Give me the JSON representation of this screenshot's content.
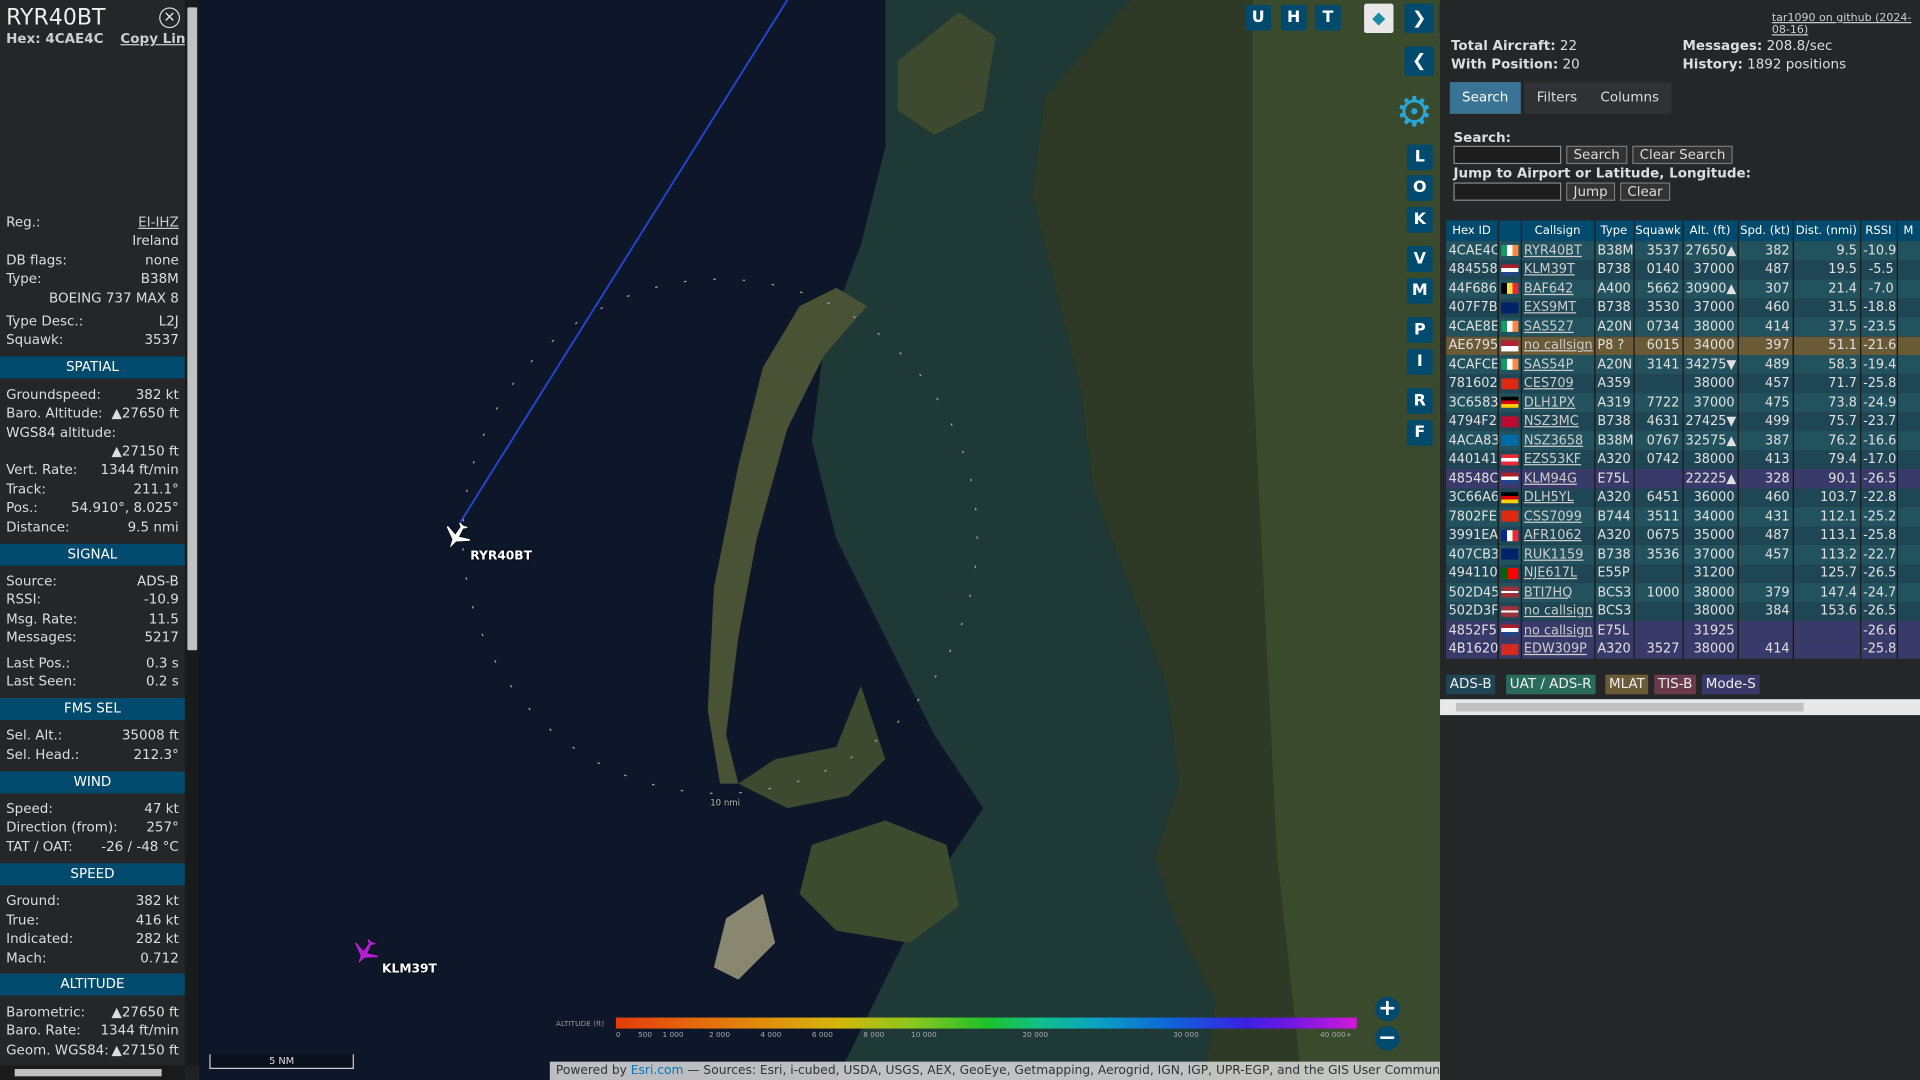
{
  "sidebar": {
    "callsign": "RYR40BT",
    "hex_label": "Hex:",
    "hex": "4CAE4C",
    "copy_link": "Copy Link",
    "reg_label": "Reg.:",
    "reg": "EI-IHZ",
    "country": "Ireland",
    "dbflags_label": "DB flags:",
    "dbflags": "none",
    "type_label": "Type:",
    "type": "B38M",
    "type_full": "BOEING 737 MAX 8",
    "typedesc_label": "Type Desc.:",
    "typedesc": "L2J",
    "squawk_label": "Squawk:",
    "squawk": "3537",
    "spatial_header": "SPATIAL",
    "gs_label": "Groundspeed:",
    "gs": "382 kt",
    "baro_label": "Baro. Altitude:",
    "baro": "▲27650 ft",
    "wgs_label": "WGS84 altitude:",
    "wgs": "▲27150 ft",
    "vr_label": "Vert. Rate:",
    "vr": "1344 ft/min",
    "track_label": "Track:",
    "track": "211.1°",
    "pos_label": "Pos.:",
    "pos": "54.910°, 8.025°",
    "dist_label": "Distance:",
    "dist": "9.5 nmi",
    "signal_header": "SIGNAL",
    "source_label": "Source:",
    "source": "ADS-B",
    "rssi_label": "RSSI:",
    "rssi": "-10.9",
    "msgrate_label": "Msg. Rate:",
    "msgrate": "11.5",
    "messages_label": "Messages:",
    "messages": "5217",
    "lastpos_label": "Last Pos.:",
    "lastpos": "0.3 s",
    "lastseen_label": "Last Seen:",
    "lastseen": "0.2 s",
    "fms_header": "FMS SEL",
    "selalt_label": "Sel. Alt.:",
    "selalt": "35008 ft",
    "selhead_label": "Sel. Head.:",
    "selhead": "212.3°",
    "wind_header": "WIND",
    "wspeed_label": "Speed:",
    "wspeed": "47 kt",
    "wdir_label": "Direction (from):",
    "wdir": "257°",
    "tat_label": "TAT / OAT:",
    "tat": "-26 / -48 °C",
    "speed_header": "SPEED",
    "ground_label": "Ground:",
    "ground": "382 kt",
    "true_label": "True:",
    "true": "416 kt",
    "ind_label": "Indicated:",
    "ind": "282 kt",
    "mach_label": "Mach:",
    "mach": "0.712",
    "alt_header": "ALTITUDE",
    "barometric_label": "Barometric:",
    "barometric": "▲27650 ft",
    "barorate_label": "Baro. Rate:",
    "barorate": "1344 ft/min",
    "geom_label": "Geom. WGS84:",
    "geom": "▲27150 ft"
  },
  "map": {
    "aircraft": [
      {
        "label": "RYR40BT",
        "color": "#ffffff"
      },
      {
        "label": "KLM39T",
        "color": "#b21fd0"
      }
    ],
    "range_ring_label": "10 nmi",
    "buttons": [
      "U",
      "H",
      "T"
    ],
    "side_buttons": [
      "L",
      "O",
      "K",
      "V",
      "M",
      "P",
      "I",
      "R",
      "F"
    ],
    "scale": "5 NM",
    "altitude_legend_label": "ALTITUDE (ft)",
    "altitude_ticks": [
      "0",
      "500",
      "1 000",
      "2 000",
      "4 000",
      "6 000",
      "8 000",
      "10 000",
      "20 000",
      "30 000",
      "40 000+"
    ],
    "zoom_in": "+",
    "zoom_out": "−",
    "attribution_prefix": "Powered by ",
    "attribution_esri": "Esri.com",
    "attribution_rest": " — Sources: Esri, i-cubed, USDA, USGS, AEX, GeoEye, Getmapping, Aerogrid, IGN, IGP, UPR-EGP, and the GIS User Community"
  },
  "panel": {
    "github": "tar1090 on github (2024-08-16)",
    "total_label": "Total Aircraft:",
    "total": "22",
    "withpos_label": "With Position:",
    "withpos": "20",
    "messages_label": "Messages:",
    "messages": "208.8/sec",
    "history_label": "History:",
    "history": "1892 positions",
    "tabs": [
      "Search",
      "Filters",
      "Columns"
    ],
    "search_label": "Search:",
    "search_btn": "Search",
    "clear_search_btn": "Clear Search",
    "jump_label": "Jump to Airport or Latitude, Longitude:",
    "jump_btn": "Jump",
    "clear_btn": "Clear",
    "columns": [
      "Hex ID",
      "",
      "Callsign",
      "Type",
      "Squawk",
      "Alt. (ft)",
      "Spd. (kt)",
      "Dist. (nmi)",
      "RSSI",
      "M"
    ],
    "rows": [
      {
        "hex": "4CAE4C",
        "flag": "ie",
        "cs": "RYR40BT",
        "type": "B38M",
        "sq": "3537",
        "alt": "27650▲",
        "spd": "382",
        "dist": "9.5",
        "rssi": "-10.9"
      },
      {
        "hex": "484558",
        "flag": "nl",
        "cs": "KLM39T",
        "type": "B738",
        "sq": "0140",
        "alt": "37000",
        "spd": "487",
        "dist": "19.5",
        "rssi": "-5.5"
      },
      {
        "hex": "44F686",
        "flag": "be",
        "cs": "BAF642",
        "type": "A400",
        "sq": "5662",
        "alt": "30900▲",
        "spd": "307",
        "dist": "21.4",
        "rssi": "-7.0"
      },
      {
        "hex": "407F7B",
        "flag": "gb",
        "cs": "EXS9MT",
        "type": "B738",
        "sq": "3530",
        "alt": "37000",
        "spd": "460",
        "dist": "31.5",
        "rssi": "-18.8"
      },
      {
        "hex": "4CAE8E",
        "flag": "ie",
        "cs": "SAS527",
        "type": "A20N",
        "sq": "0734",
        "alt": "38000",
        "spd": "414",
        "dist": "37.5",
        "rssi": "-23.5"
      },
      {
        "hex": "AE6795",
        "flag": "us",
        "cs": "no callsign",
        "type": "P8 ?",
        "sq": "6015",
        "alt": "34000",
        "spd": "397",
        "dist": "51.1",
        "rssi": "-21.6"
      },
      {
        "hex": "4CAFCE",
        "flag": "ie",
        "cs": "SAS54P",
        "type": "A20N",
        "sq": "3141",
        "alt": "34275▼",
        "spd": "489",
        "dist": "58.3",
        "rssi": "-19.4"
      },
      {
        "hex": "781602",
        "flag": "cn",
        "cs": "CES709",
        "type": "A359",
        "sq": "",
        "alt": "38000",
        "spd": "457",
        "dist": "71.7",
        "rssi": "-25.8"
      },
      {
        "hex": "3C6583",
        "flag": "de",
        "cs": "DLH1PX",
        "type": "A319",
        "sq": "7722",
        "alt": "37000",
        "spd": "475",
        "dist": "73.8",
        "rssi": "-24.9"
      },
      {
        "hex": "4794F2",
        "flag": "no",
        "cs": "NSZ3MC",
        "type": "B738",
        "sq": "4631",
        "alt": "27425▼",
        "spd": "499",
        "dist": "75.7",
        "rssi": "-23.7"
      },
      {
        "hex": "4ACA83",
        "flag": "se",
        "cs": "NSZ3658",
        "type": "B38M",
        "sq": "0767",
        "alt": "32575▲",
        "spd": "387",
        "dist": "76.2",
        "rssi": "-16.6"
      },
      {
        "hex": "440141",
        "flag": "at",
        "cs": "EZS53KF",
        "type": "A320",
        "sq": "0742",
        "alt": "38000",
        "spd": "413",
        "dist": "79.4",
        "rssi": "-17.0"
      },
      {
        "hex": "48548C",
        "flag": "nl",
        "cs": "KLM94G",
        "type": "E75L",
        "sq": "",
        "alt": "22225▲",
        "spd": "328",
        "dist": "90.1",
        "rssi": "-26.5"
      },
      {
        "hex": "3C66A6",
        "flag": "de",
        "cs": "DLH5YL",
        "type": "A320",
        "sq": "6451",
        "alt": "36000",
        "spd": "460",
        "dist": "103.7",
        "rssi": "-22.8"
      },
      {
        "hex": "7802FE",
        "flag": "cn",
        "cs": "CSS7099",
        "type": "B744",
        "sq": "3511",
        "alt": "34000",
        "spd": "431",
        "dist": "112.1",
        "rssi": "-25.2"
      },
      {
        "hex": "3991EA",
        "flag": "fr",
        "cs": "AFR1062",
        "type": "A320",
        "sq": "0675",
        "alt": "35000",
        "spd": "487",
        "dist": "113.1",
        "rssi": "-25.8"
      },
      {
        "hex": "407CB3",
        "flag": "gb",
        "cs": "RUK1159",
        "type": "B738",
        "sq": "3536",
        "alt": "37000",
        "spd": "457",
        "dist": "113.2",
        "rssi": "-22.7"
      },
      {
        "hex": "494110",
        "flag": "pt",
        "cs": "NJE617L",
        "type": "E55P",
        "sq": "",
        "alt": "31200",
        "spd": "",
        "dist": "125.7",
        "rssi": "-26.5"
      },
      {
        "hex": "502D45",
        "flag": "lv",
        "cs": "BTI7HQ",
        "type": "BCS3",
        "sq": "1000",
        "alt": "38000",
        "spd": "379",
        "dist": "147.4",
        "rssi": "-24.7"
      },
      {
        "hex": "502D3F",
        "flag": "lv",
        "cs": "no callsign",
        "type": "BCS3",
        "sq": "",
        "alt": "38000",
        "spd": "384",
        "dist": "153.6",
        "rssi": "-26.5"
      },
      {
        "hex": "4852F5",
        "flag": "nl",
        "cs": "no callsign",
        "type": "E75L",
        "sq": "",
        "alt": "31925",
        "spd": "",
        "dist": "",
        "rssi": "-26.6"
      },
      {
        "hex": "4B1620",
        "flag": "ch",
        "cs": "EDW309P",
        "type": "A320",
        "sq": "3527",
        "alt": "38000",
        "spd": "414",
        "dist": "",
        "rssi": "-25.8"
      }
    ],
    "legend": [
      {
        "label": "ADS-B",
        "color": "#1f4654"
      },
      {
        "label": "UAT / ADS-R",
        "color": "#2a6a5a"
      },
      {
        "label": "MLAT",
        "color": "#6a5a36"
      },
      {
        "label": "TIS-B",
        "color": "#6a3a4a"
      },
      {
        "label": "Mode-S",
        "color": "#3a3a6a"
      }
    ]
  }
}
